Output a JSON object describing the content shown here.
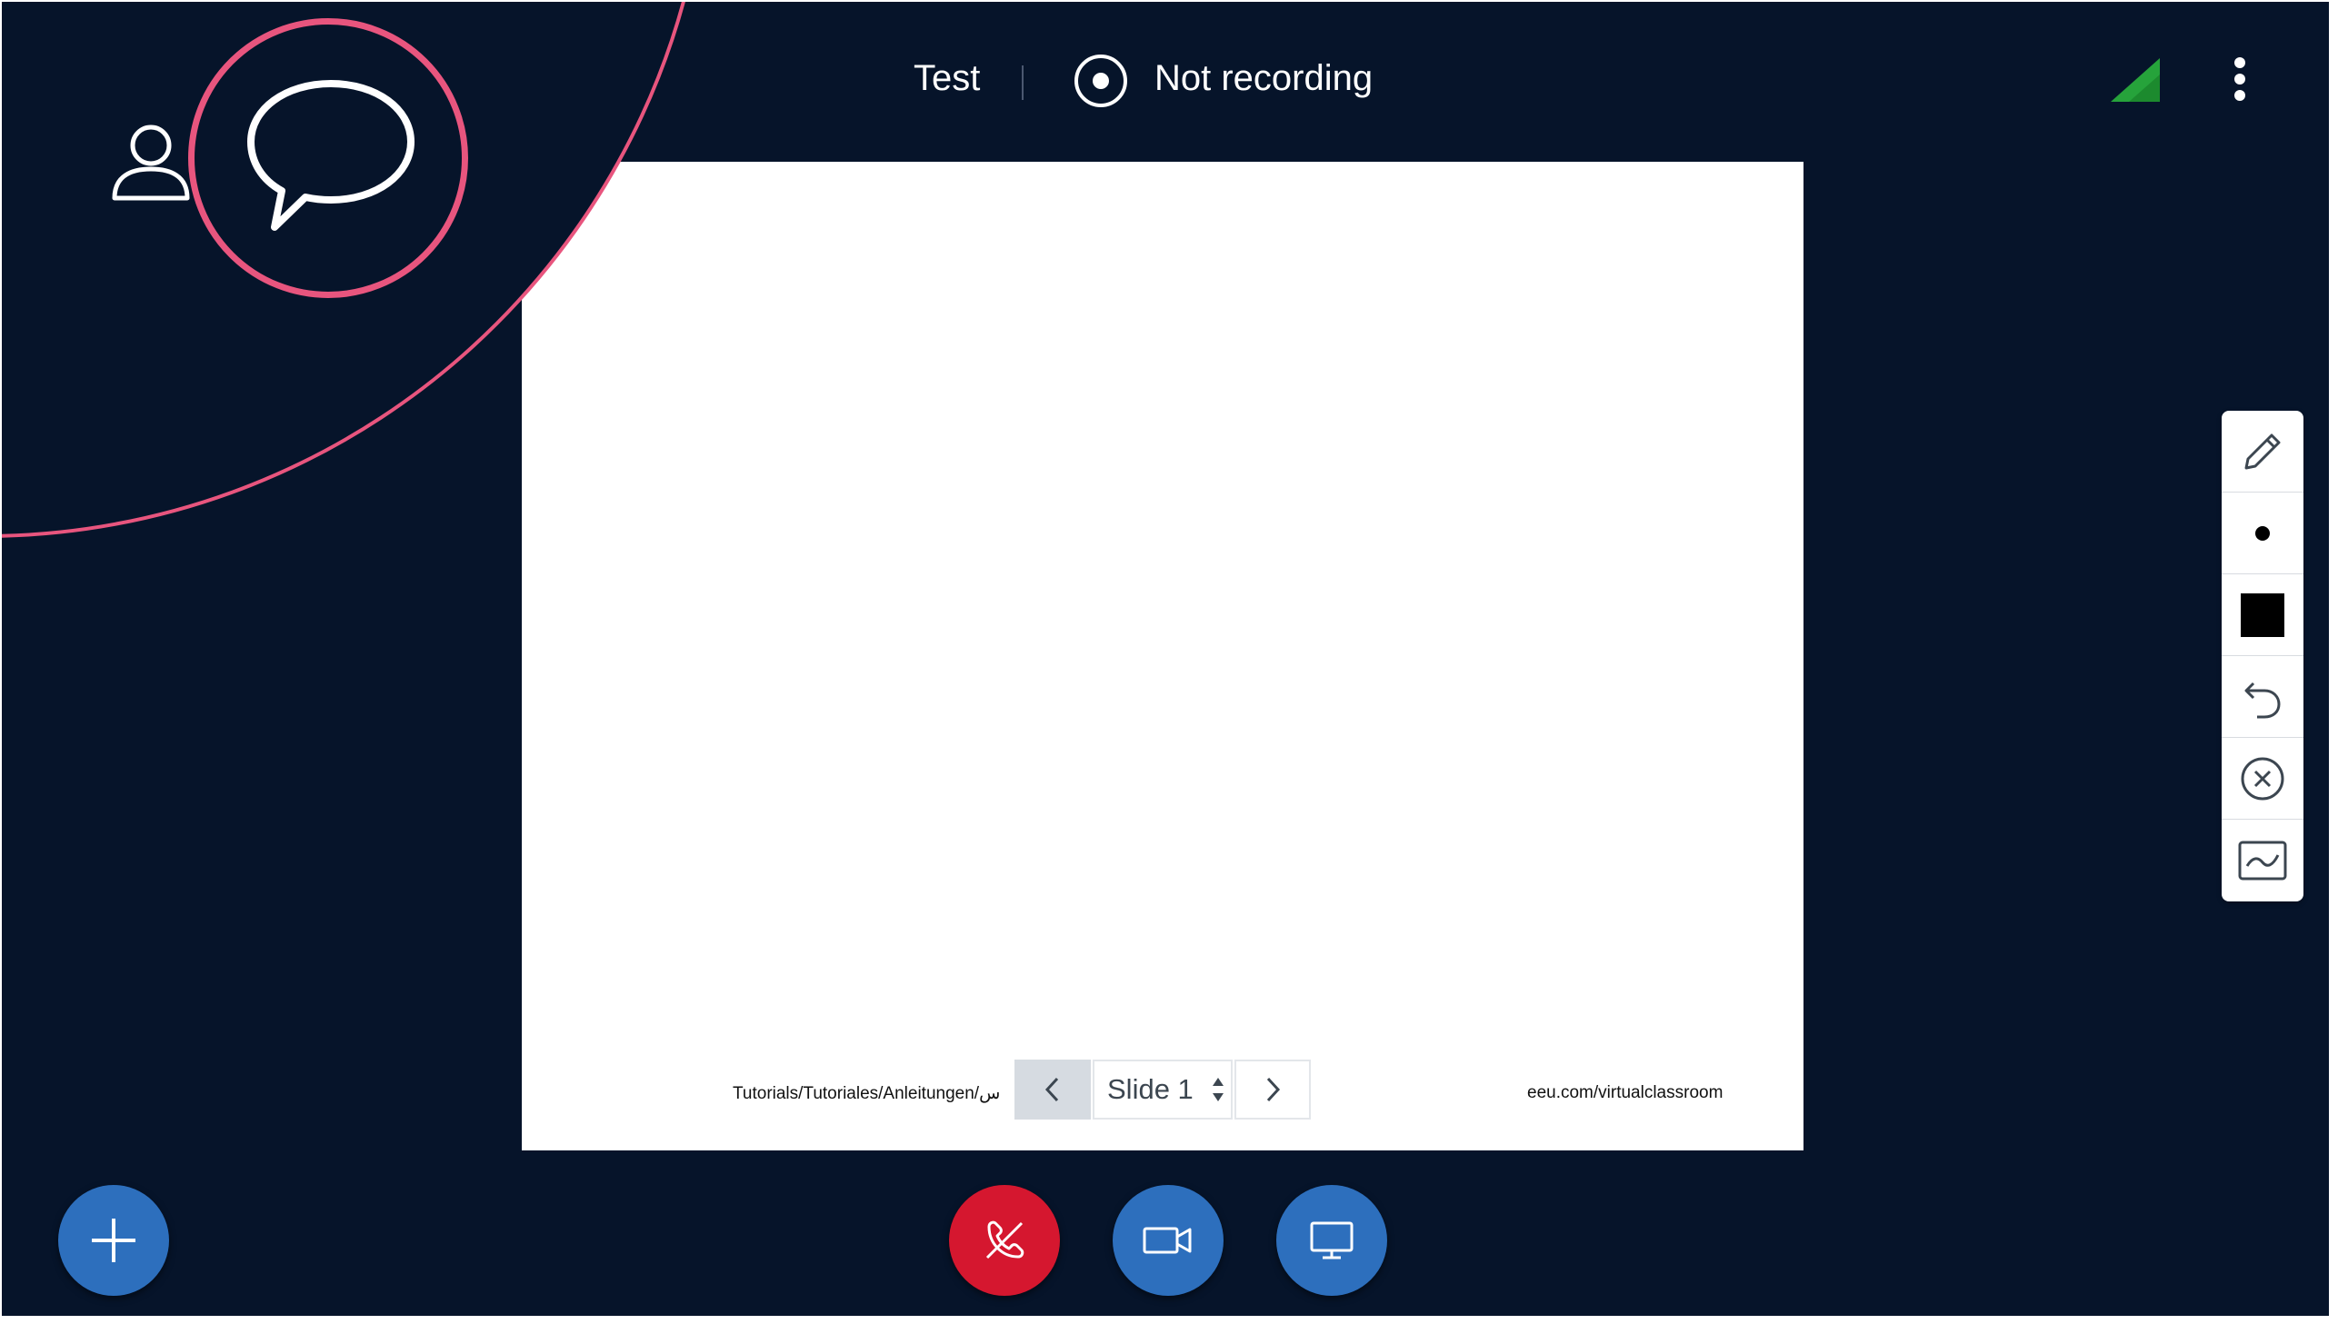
{
  "header": {
    "meeting_title": "Test",
    "recording_label": "Not recording",
    "recording_icon": "record-icon",
    "connection_icon": "signal-icon",
    "options_icon": "more-vertical-icon"
  },
  "overlay": {
    "users_icon": "user-icon",
    "chat_icon": "chat-bubble-icon",
    "highlight_color": "#e8557e"
  },
  "slide": {
    "footer_left": "Tutorials/Tutoriales/Anleitungen/س",
    "footer_right": "eeu.com/virtualclassroom"
  },
  "slide_nav": {
    "prev_icon": "chevron-left-icon",
    "current_slide": "Slide 1",
    "next_icon": "chevron-right-icon"
  },
  "annotation_tools": [
    {
      "name": "pencil-icon"
    },
    {
      "name": "thickness-dot-icon"
    },
    {
      "name": "color-square-icon",
      "color": "#000000"
    },
    {
      "name": "undo-icon"
    },
    {
      "name": "clear-icon"
    },
    {
      "name": "multi-user-whiteboard-icon"
    }
  ],
  "bottom_controls": {
    "actions_icon": "plus-icon",
    "hangup_icon": "phone-hangup-icon",
    "camera_icon": "video-camera-icon",
    "screenshare_icon": "desktop-icon"
  },
  "colors": {
    "background": "#06142a",
    "accent_blue": "#2d6fbd",
    "danger_red": "#d5172f",
    "signal_green": "#26a33b",
    "highlight_pink": "#e8557e"
  }
}
